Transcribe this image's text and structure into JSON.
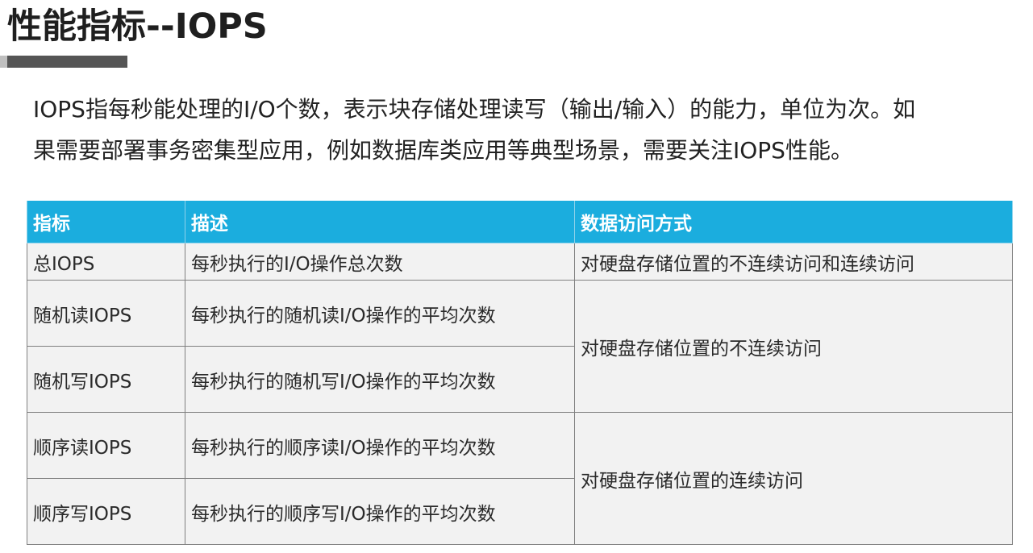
{
  "slide": {
    "title": "性能指标--IOPS",
    "intro_line1": "IOPS指每秒能处理的I/O个数，表示块存储处理读写（输出/输入）的能力，单位为次。如",
    "intro_line2": "果需要部署事务密集型应用，例如数据库类应用等典型场景，需要关注IOPS性能。"
  },
  "table": {
    "headers": [
      "指标",
      "描述",
      "数据访问方式"
    ],
    "rows": [
      {
        "metric": "总IOPS",
        "description": "每秒执行的I/O操作总次数",
        "access": "对硬盘存储位置的不连续访问和连续访问"
      },
      {
        "metric": "随机读IOPS",
        "description": "每秒执行的随机读I/O操作的平均次数",
        "access": "对硬盘存储位置的不连续访问"
      },
      {
        "metric": "随机写IOPS",
        "description": "每秒执行的随机写I/O操作的平均次数"
      },
      {
        "metric": "顺序读IOPS",
        "description": "每秒执行的顺序读I/O操作的平均次数",
        "access": "对硬盘存储位置的连续访问"
      },
      {
        "metric": "顺序写IOPS",
        "description": "每秒执行的顺序写I/O操作的平均次数"
      }
    ]
  },
  "colors": {
    "header_bg": "#1badde",
    "cell_bg": "#f2f2f2",
    "title_bar": "#555555"
  }
}
